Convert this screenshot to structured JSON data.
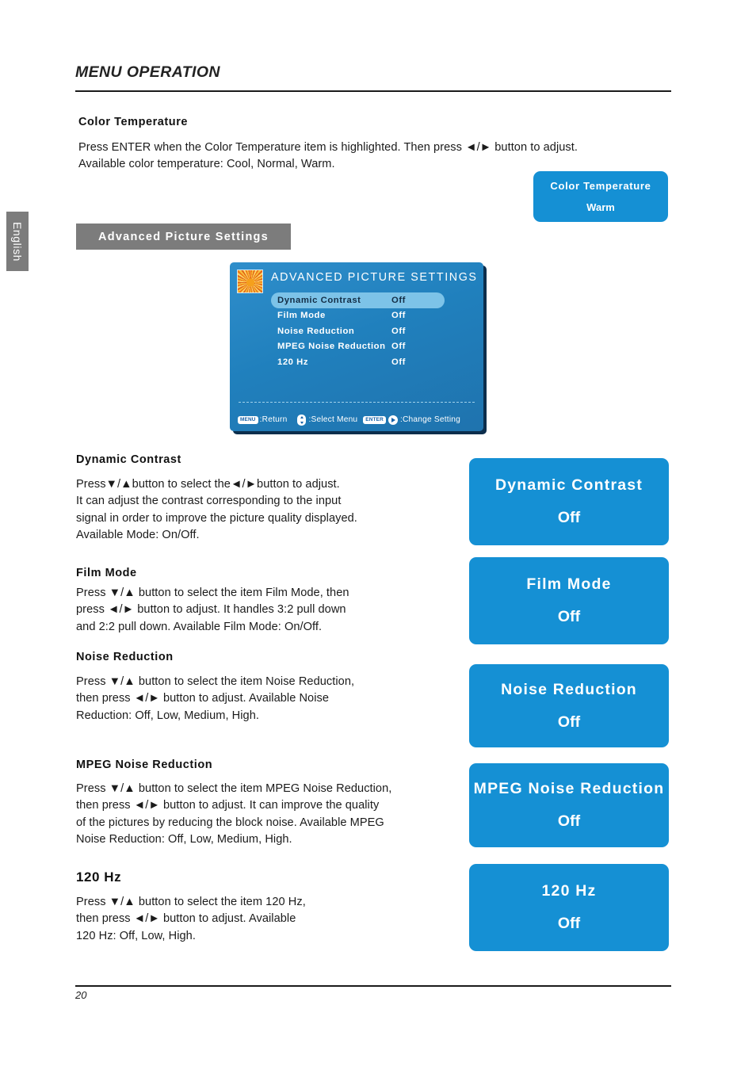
{
  "header": {
    "running_head": "MENU OPERATION",
    "side_tab": "English"
  },
  "color_temperature": {
    "heading": "Color Temperature",
    "body": "Press ENTER when the Color Temperature item is highlighted. Then press ◄/► button to adjust.\nAvailable color temperature: Cool, Normal, Warm."
  },
  "gray_bar": {
    "label": "Advanced Picture Settings"
  },
  "osd": {
    "title": "ADVANCED PICTURE SETTINGS",
    "thumbnail_icon": "flower-thumbnail-icon",
    "rows": [
      {
        "label": "Dynamic Contrast",
        "value": "Off",
        "selected": true
      },
      {
        "label": "Film Mode",
        "value": "Off",
        "selected": false
      },
      {
        "label": "Noise Reduction",
        "value": "Off",
        "selected": false
      },
      {
        "label": "MPEG Noise Reduction",
        "value": "Off",
        "selected": false
      },
      {
        "label": "120 Hz",
        "value": "Off",
        "selected": false
      }
    ],
    "footer": {
      "menu_key": "MENU",
      "menu_action": ":Return",
      "updown_icon": "up-down-arrows-icon",
      "updown_action": ":Select Menu",
      "enter_key": "ENTER",
      "right_icon": "right-arrow-icon",
      "enter_action": ":Change Setting"
    }
  },
  "sections": [
    {
      "heading": "Dynamic Contrast",
      "body": "Press▼/▲button to select the◄/►button to adjust.\nIt can adjust the contrast corresponding to the input\nsignal in order to improve the picture quality displayed.\nAvailable Mode: On/Off."
    },
    {
      "heading": "Film Mode",
      "body": "Press ▼/▲ button to select the item Film Mode, then\npress ◄/► button to adjust. It handles 3:2 pull down\nand 2:2 pull down. Available Film Mode: On/Off."
    },
    {
      "heading": "Noise Reduction",
      "body": "Press ▼/▲ button to select the item Noise Reduction,\nthen press ◄/► button to adjust. Available Noise\nReduction: Off, Low, Medium, High."
    },
    {
      "heading": "MPEG Noise Reduction",
      "body": "Press ▼/▲ button to select the item MPEG Noise Reduction,\nthen press ◄/► button to adjust. It can improve the quality\nof the pictures by reducing the block noise. Available MPEG\nNoise Reduction: Off, Low, Medium, High."
    },
    {
      "heading": "120 Hz",
      "body": "Press ▼/▲ button to select the item 120 Hz,\nthen press ◄/► button to adjust. Available\n120 Hz: Off, Low, High."
    }
  ],
  "callouts": [
    {
      "title": "Color Temperature",
      "value": "Warm"
    },
    {
      "title": "Dynamic Contrast",
      "value": "Off"
    },
    {
      "title": "Film Mode",
      "value": "Off"
    },
    {
      "title": "Noise Reduction",
      "value": "Off"
    },
    {
      "title": "MPEG Noise Reduction",
      "value": "Off"
    },
    {
      "title": "120 Hz",
      "value": "Off"
    }
  ],
  "footer": {
    "page_number": "20"
  },
  "colors": {
    "callout_blue": "#1590d4",
    "osd_blue": "#2080bd",
    "osd_highlight": "#7dc3e8",
    "gray_bar": "#7c7c7c"
  }
}
